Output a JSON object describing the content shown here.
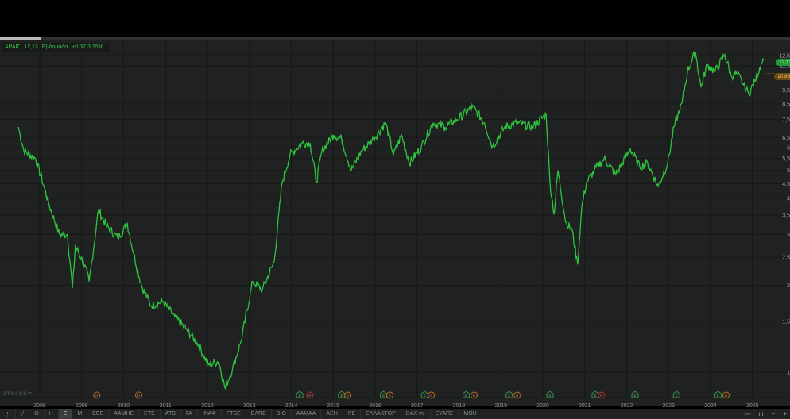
{
  "legend": {
    "symbol": "ΑΡΑΙΓ",
    "price": "12,13",
    "period": "Εβδομάδα",
    "change": "+0,37 3,15%"
  },
  "logo": "ZTRADE™",
  "badges": {
    "last": "12,13",
    "ref": "10,83"
  },
  "colors": {
    "line": "#2fc23f",
    "last_badge": "#1f9a35",
    "ref_badge": "#6b4a12",
    "dividend": "#c56a14",
    "earnings": "#2b9a3d",
    "red": "#c0282b"
  },
  "toolbar": {
    "items": [
      "Ο",
      "Η",
      "Ε",
      "Μ",
      "ΕΕΕ",
      "ΑΑΜΗΕ",
      "ΕΤΕ",
      "ΑΤΒ",
      "ΓΑ",
      "ΙΝΑΦ",
      "FTSE",
      "ΕΛΠΕ",
      "ΒΙΟ",
      "ΑΑΜΑΑ",
      "ΑΕΗ",
      "ΡΕ",
      "ΕΛΛΑΚΤΟΡ",
      "DAX mi",
      "ΕΥΑΠΣ",
      "ΜΟΗ"
    ],
    "selected": "Ε"
  },
  "chart_data": {
    "type": "line",
    "scale": "log",
    "title": "ΑΡΑΙΓ Εβδομάδα",
    "xlabel": "",
    "ylabel": "",
    "xlim": [
      2007.4,
      2025.9
    ],
    "ylim": [
      0.85,
      13.5
    ],
    "x_ticks": [
      "2008",
      "2009",
      "2010",
      "2011",
      "2012",
      "2013",
      "2014",
      "2015",
      "2016",
      "2017",
      "2018",
      "2019",
      "2020",
      "2021",
      "2022",
      "2023",
      "2024",
      "2025"
    ],
    "y_ticks": [
      "12,5",
      "11,5",
      "9,5",
      "8,5",
      "7,5",
      "6,5",
      "6",
      "5,5",
      "5",
      "4,5",
      "4",
      "3,5",
      "3",
      "2,5",
      "2",
      "1,5",
      "1"
    ],
    "y_tick_values": [
      12.5,
      11.5,
      9.5,
      8.5,
      7.5,
      6.5,
      6,
      5.5,
      5,
      4.5,
      4,
      3.5,
      3,
      2.5,
      2,
      1.5,
      1
    ],
    "series": [
      {
        "name": "ΑΡΑΙΓ",
        "x": [
          2007.49,
          2007.62,
          2007.9,
          2008.1,
          2008.23,
          2008.47,
          2008.66,
          2008.78,
          2008.85,
          2009.04,
          2009.18,
          2009.4,
          2009.6,
          2009.86,
          2010.09,
          2010.24,
          2010.43,
          2010.65,
          2010.94,
          2011.22,
          2011.5,
          2011.79,
          2012.02,
          2012.27,
          2012.42,
          2012.6,
          2012.8,
          2013.08,
          2013.31,
          2013.59,
          2013.78,
          2013.97,
          2014.26,
          2014.45,
          2014.6,
          2014.73,
          2015.01,
          2015.2,
          2015.43,
          2015.68,
          2015.96,
          2016.25,
          2016.44,
          2016.63,
          2016.82,
          2017.1,
          2017.38,
          2017.67,
          2017.95,
          2018.33,
          2018.61,
          2018.8,
          2019.09,
          2019.37,
          2019.75,
          2020.08,
          2020.17,
          2020.27,
          2020.36,
          2020.55,
          2020.7,
          2020.83,
          2020.93,
          2021.04,
          2021.23,
          2021.46,
          2021.74,
          2022.09,
          2022.31,
          2022.5,
          2022.75,
          2022.98,
          2023.13,
          2023.32,
          2023.45,
          2023.64,
          2023.77,
          2023.92,
          2024.11,
          2024.34,
          2024.49,
          2024.64,
          2024.77,
          2024.91,
          2025.06,
          2025.21,
          2025.27
        ],
        "y": [
          7.07,
          5.85,
          5.5,
          4.4,
          3.77,
          3.0,
          3.0,
          1.96,
          2.73,
          2.41,
          2.06,
          3.64,
          3.2,
          2.92,
          3.27,
          2.57,
          1.99,
          1.7,
          1.76,
          1.55,
          1.41,
          1.24,
          1.06,
          1.09,
          0.88,
          1.03,
          1.28,
          2.06,
          1.93,
          2.41,
          4.54,
          5.66,
          6.22,
          6.22,
          4.54,
          5.85,
          6.63,
          6.43,
          5.0,
          5.85,
          6.43,
          7.3,
          5.66,
          6.63,
          5.3,
          6.03,
          7.3,
          7.07,
          7.5,
          8.3,
          7.3,
          6.03,
          7.07,
          7.3,
          7.07,
          7.8,
          4.54,
          3.52,
          5.0,
          3.3,
          3.1,
          2.36,
          3.75,
          4.54,
          5.0,
          5.5,
          4.84,
          5.93,
          5.15,
          5.3,
          4.4,
          5.3,
          7.07,
          8.55,
          11.0,
          12.9,
          9.7,
          11.6,
          11.0,
          12.6,
          10.65,
          10.8,
          10.0,
          9.2,
          10.2,
          11.75,
          12.13
        ]
      }
    ],
    "last_value": 12.13,
    "reference_value": 10.83,
    "events": [
      {
        "year": 2009.36,
        "type": "D"
      },
      {
        "year": 2010.36,
        "type": "D"
      },
      {
        "year": 2014.2,
        "type": "E"
      },
      {
        "year": 2014.44,
        "type": "R"
      },
      {
        "year": 2015.2,
        "type": "E"
      },
      {
        "year": 2015.35,
        "type": "D"
      },
      {
        "year": 2016.2,
        "type": "E"
      },
      {
        "year": 2016.35,
        "type": "D"
      },
      {
        "year": 2017.18,
        "type": "E"
      },
      {
        "year": 2017.34,
        "type": "D"
      },
      {
        "year": 2018.17,
        "type": "E"
      },
      {
        "year": 2018.36,
        "type": "D"
      },
      {
        "year": 2019.2,
        "type": "E"
      },
      {
        "year": 2019.39,
        "type": "D"
      },
      {
        "year": 2020.17,
        "type": "E"
      },
      {
        "year": 2021.25,
        "type": "E"
      },
      {
        "year": 2021.4,
        "type": "R"
      },
      {
        "year": 2022.2,
        "type": "E"
      },
      {
        "year": 2023.19,
        "type": "E"
      },
      {
        "year": 2024.18,
        "type": "E"
      },
      {
        "year": 2024.37,
        "type": "D"
      }
    ],
    "grid": true,
    "legend": "top-left"
  }
}
